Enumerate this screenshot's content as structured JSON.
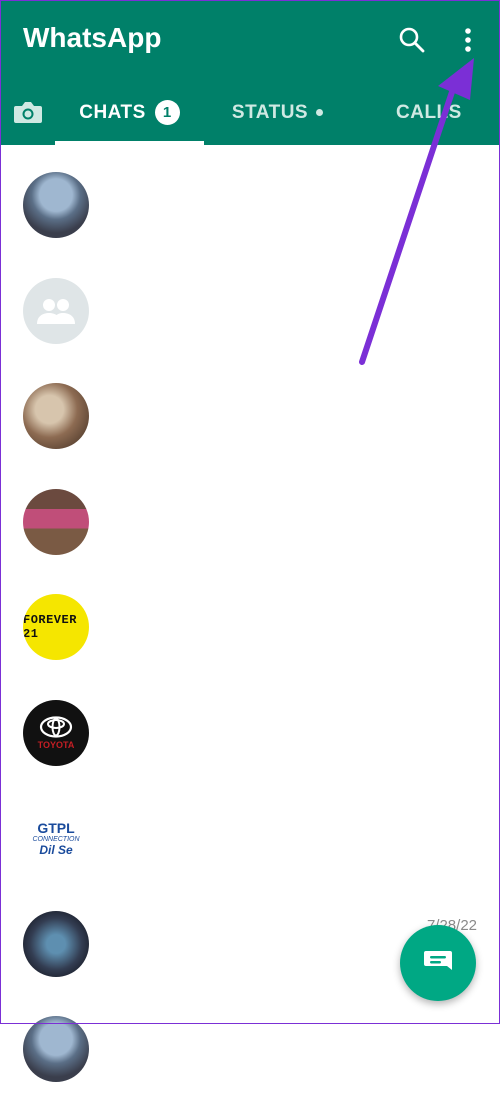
{
  "app": {
    "title": "WhatsApp"
  },
  "header_icons": [
    "search-icon",
    "more-vertical-icon"
  ],
  "tabs": [
    {
      "label": "CHATS",
      "badge": "1",
      "active": true
    },
    {
      "label": "STATUS",
      "has_dot": true
    },
    {
      "label": "CALLS"
    }
  ],
  "chats": [
    {
      "avatar": "photo-people"
    },
    {
      "avatar": "group-default-icon"
    },
    {
      "avatar": "photo-people"
    },
    {
      "avatar": "photo-people"
    },
    {
      "avatar": "forever21-logo",
      "logo_text": "FOREVER 21"
    },
    {
      "avatar": "toyota-logo",
      "logo_text": "TOYOTA"
    },
    {
      "avatar": "gtpl-logo",
      "logo_text": "GTPL",
      "logo_sub1": "CONNECTION",
      "logo_sub2": "Dil Se"
    },
    {
      "avatar": "photo-people",
      "time": "7/28/22"
    },
    {
      "avatar": "photo-people"
    }
  ],
  "colors": {
    "header": "#008069",
    "fab": "#00a884",
    "annotation_arrow": "#7b2fd6"
  }
}
